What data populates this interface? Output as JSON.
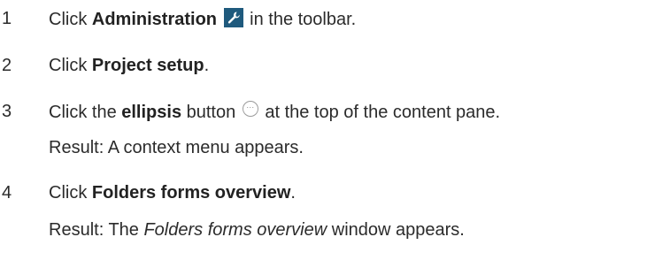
{
  "steps": [
    {
      "number": "1",
      "pre": "Click ",
      "bold": "Administration",
      "icon": "wrench-icon",
      "post": " in the toolbar."
    },
    {
      "number": "2",
      "pre": "Click ",
      "bold": "Project setup",
      "post": "."
    },
    {
      "number": "3",
      "pre": "Click the ",
      "bold": "ellipsis",
      "mid": " button ",
      "icon": "ellipsis-icon",
      "post": " at the top of the content pane.",
      "result": "Result: A context menu appears."
    },
    {
      "number": "4",
      "pre": "Click ",
      "bold": "Folders forms overview",
      "post": ".",
      "result_pre": "Result: The ",
      "result_italic": "Folders forms overview",
      "result_post": " window appears."
    }
  ],
  "colors": {
    "text": "#2b2b2b",
    "admin_icon_bg": "#1f5a7d",
    "ellipsis_icon_border": "#9a9a9a"
  }
}
